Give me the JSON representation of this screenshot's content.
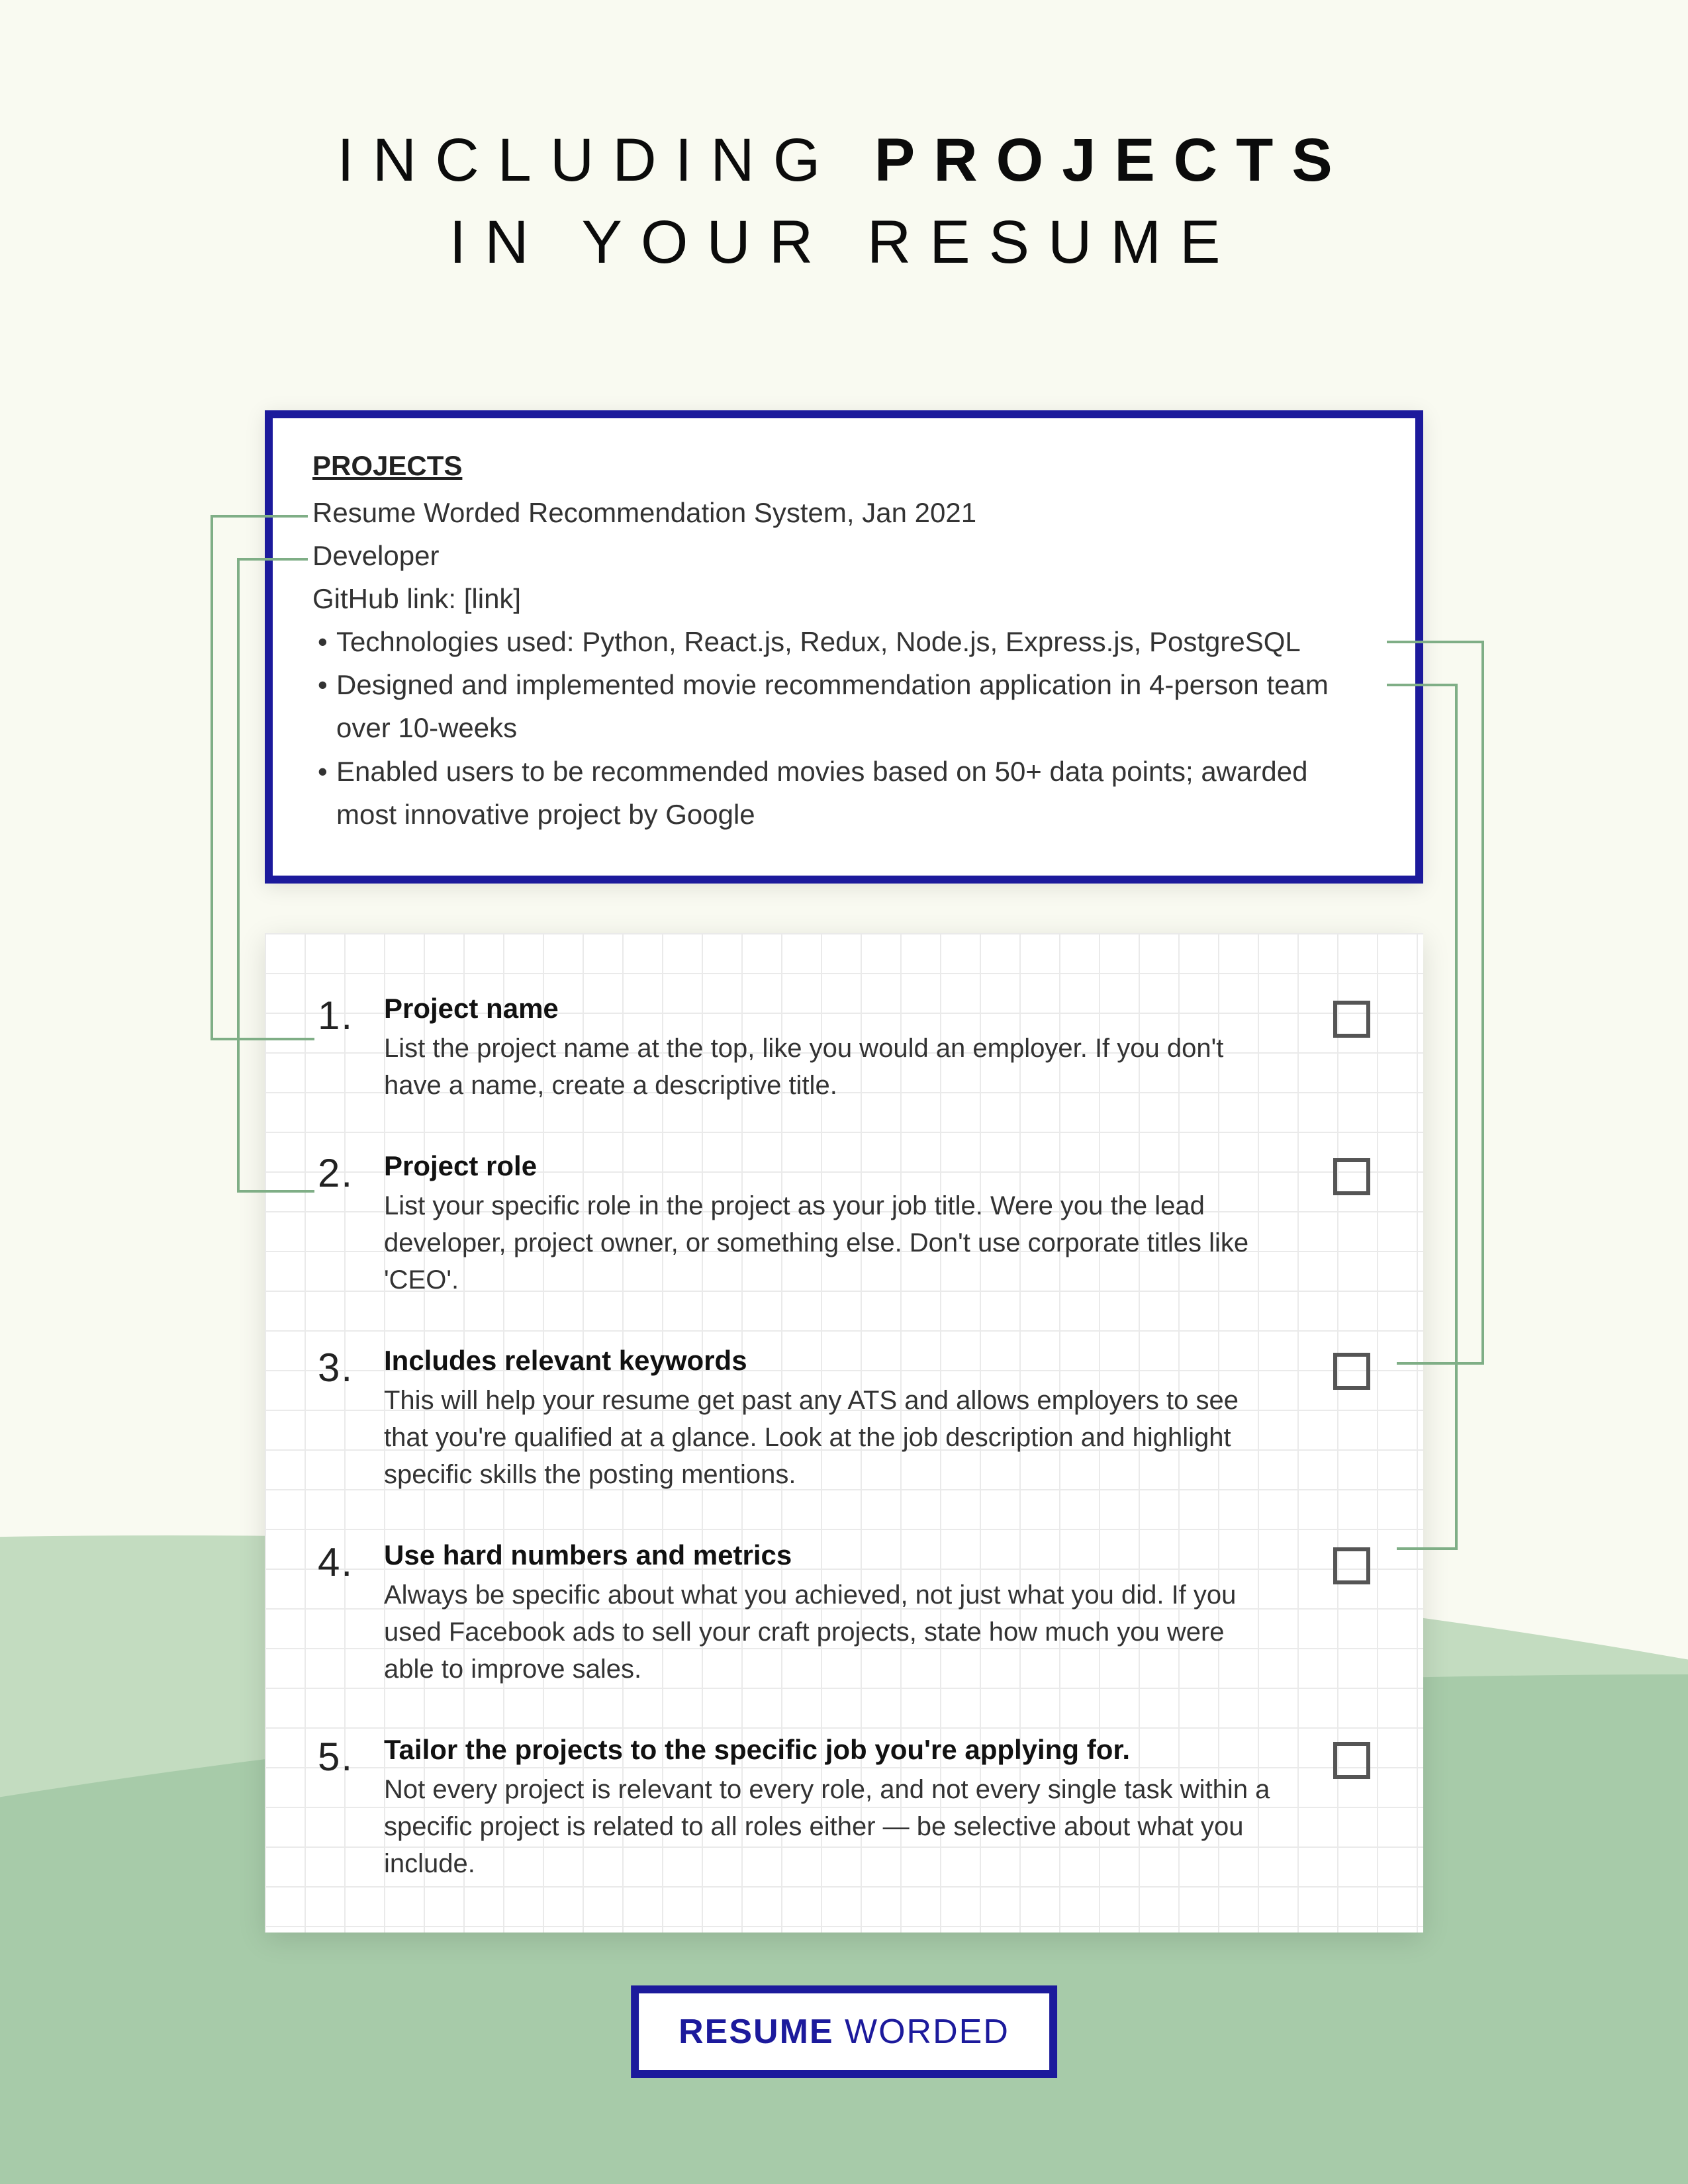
{
  "header": {
    "line1_pre": "Including ",
    "line1_bold": "Projects",
    "line2": "In Your Resume"
  },
  "example": {
    "heading": "PROJECTS",
    "title_line": "Resume Worded Recommendation System, Jan 2021",
    "role_line": "Developer",
    "link_line": "GitHub link: [link]",
    "bullets": [
      "Technologies used: Python, React.js, Redux, Node.js, Express.js, PostgreSQL",
      "Designed and implemented movie recommendation application in 4-person team over 10-weeks",
      "Enabled users to be recommended movies based on 50+ data points; awarded most innovative project by Google"
    ]
  },
  "checklist": [
    {
      "num": "1.",
      "title": "Project name",
      "desc": "List the project name at the top, like you would an employer. If you don't have a name, create a descriptive title."
    },
    {
      "num": "2.",
      "title": "Project role",
      "desc": "List your specific role in the project as your job title. Were you the lead developer, project owner, or something else. Don't use corporate titles like 'CEO'."
    },
    {
      "num": "3.",
      "title": "Includes relevant keywords",
      "desc": "This will help your resume get past any ATS and allows employers to see that you're qualified at a glance. Look at the job description and highlight specific skills the posting mentions."
    },
    {
      "num": "4.",
      "title": "Use hard numbers and métrics",
      "desc": "Always be specific about what you achieved, not just what you did. If you used Facebook ads to sell your craft projects, state how much you were able to improve sales."
    },
    {
      "num": "5.",
      "title": "Tailor the projects to the specific job you're applying for.",
      "desc": "Not every project is relevant to every role, and not every single task within a specific project is related to all roles either — be selective about what you include."
    }
  ],
  "footer": {
    "brand_bold": "RESUME",
    "brand_light": " WORDED"
  }
}
